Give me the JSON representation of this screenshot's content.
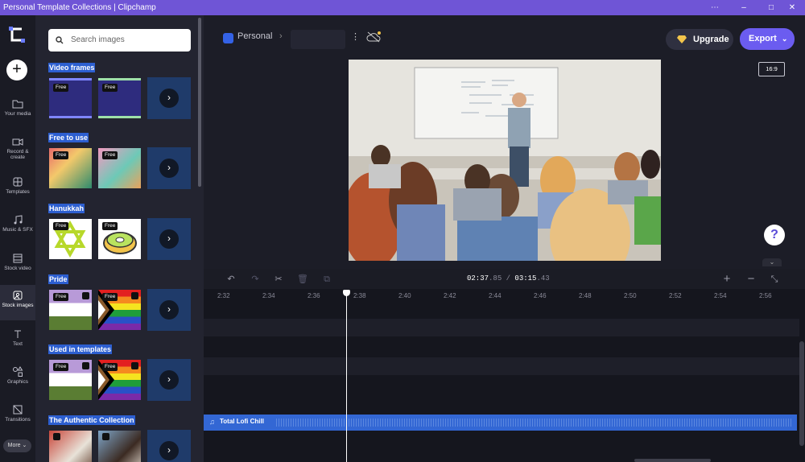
{
  "window": {
    "title": "Personal Template Collections | Clipchamp",
    "controls": [
      "⋯",
      "–",
      "□",
      "✕"
    ]
  },
  "nav": {
    "items": [
      {
        "label": "Your media",
        "icon": "folder-icon"
      },
      {
        "label": "Record & create",
        "icon": "camera-icon"
      },
      {
        "label": "Templates",
        "icon": "grid-icon"
      },
      {
        "label": "Music & SFX",
        "icon": "music-icon"
      },
      {
        "label": "Stock video",
        "icon": "film-icon"
      },
      {
        "label": "Stock images",
        "icon": "image-icon"
      },
      {
        "label": "Text",
        "icon": "text-icon"
      },
      {
        "label": "Graphics",
        "icon": "shapes-icon"
      },
      {
        "label": "Transitions",
        "icon": "transition-icon"
      }
    ],
    "active": "Stock images",
    "more_label": "More ⌄"
  },
  "panel": {
    "search_placeholder": "Search images",
    "sections": [
      {
        "title": "Video frames",
        "thumbs": [
          {
            "badge": "Free",
            "crown": false
          },
          {
            "badge": "Free",
            "crown": false
          }
        ]
      },
      {
        "title": "Free to use",
        "thumbs": [
          {
            "badge": "Free",
            "crown": false
          },
          {
            "badge": "Free",
            "crown": false
          }
        ]
      },
      {
        "title": "Hanukkah",
        "thumbs": [
          {
            "badge": "Free",
            "crown": false
          },
          {
            "badge": "Free",
            "crown": false
          }
        ]
      },
      {
        "title": "Pride",
        "thumbs": [
          {
            "badge": "Free",
            "crown": true
          },
          {
            "badge": "Free",
            "crown": true
          }
        ]
      },
      {
        "title": "Used in templates",
        "thumbs": [
          {
            "badge": "Free",
            "crown": true
          },
          {
            "badge": "Free",
            "crown": true
          }
        ]
      },
      {
        "title": "The Authentic Collection",
        "thumbs": [
          {
            "badge": "",
            "crown": false
          },
          {
            "badge": "",
            "crown": false
          }
        ]
      }
    ]
  },
  "header": {
    "project": "Personal",
    "upgrade": "Upgrade",
    "export": "Export",
    "aspect_ratio": "16:9",
    "help": "?"
  },
  "timeline": {
    "current_time": "02:37",
    "current_frames": ".85",
    "separator": " / ",
    "total_time": "03:15",
    "total_frames": ".43",
    "ruler_ticks": [
      "2:32",
      "2:34",
      "2:36",
      "2:38",
      "2:40",
      "2:42",
      "2:44",
      "2:46",
      "2:48",
      "2:50",
      "2:52",
      "2:54",
      "2:56"
    ],
    "audio_track_label": "Total Lofi Chill",
    "toolbar_icons": [
      "undo-icon",
      "redo-icon",
      "scissors-icon",
      "trash-icon",
      "copy-icon",
      "zoom-in-icon",
      "zoom-out-icon",
      "fit-icon"
    ]
  },
  "colors": {
    "accent": "#6b5cf0",
    "titlebar": "#6f55d6",
    "audio": "#3367d4",
    "section_highlight": "#2d5fd0"
  }
}
